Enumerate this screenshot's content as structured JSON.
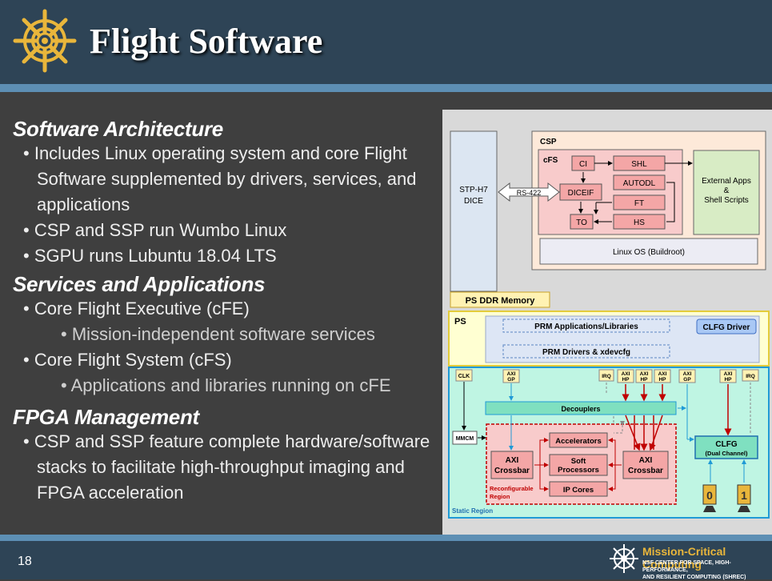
{
  "header": {
    "title": "Flight Software"
  },
  "content": {
    "sections": [
      {
        "heading": "Software Architecture",
        "items": [
          {
            "level": 1,
            "text": "Includes Linux operating system and core Flight Software supplemented by drivers, services, and applications"
          },
          {
            "level": 1,
            "text": "CSP and SSP run Wumbo Linux"
          },
          {
            "level": 1,
            "text": "SGPU runs Lubuntu 18.04 LTS"
          }
        ]
      },
      {
        "heading": "Services and Applications",
        "items": [
          {
            "level": 1,
            "text": "Core Flight Executive (cFE)"
          },
          {
            "level": 2,
            "text": "Mission-independent software services"
          },
          {
            "level": 1,
            "text": "Core Flight System (cFS)"
          },
          {
            "level": 2,
            "text": "Applications and libraries running on cFE"
          }
        ]
      },
      {
        "heading": "FPGA Management",
        "items": [
          {
            "level": 1,
            "text": "CSP and SSP feature complete hardware/software stacks to facilitate high-throughput imaging and FPGA acceleration"
          }
        ]
      }
    ]
  },
  "footer": {
    "page_number": "18",
    "org_name": "Mission-Critical Computing",
    "org_line1": "NSF CENTER FOR SPACE, HIGH-PERFORMANCE,",
    "org_line2": "AND RESILIENT COMPUTING (SHREC)"
  },
  "diagram": {
    "stp_line1": "STP-H7",
    "stp_line2": "DICE",
    "rs422": "RS-422",
    "csp": "CSP",
    "cfs": "cFS",
    "ci": "CI",
    "shl": "SHL",
    "autodl": "AUTODL",
    "diceif": "DICEIF",
    "ft": "FT",
    "to": "TO",
    "hs": "HS",
    "ext_line1": "External Apps",
    "ext_line2": "&",
    "ext_line3": "Shell Scripts",
    "linux_os": "Linux OS (Buildroot)",
    "ps_ddr": "PS DDR Memory",
    "ps": "PS",
    "prm_apps": "PRM Applications/Libraries",
    "clfg_driver": "CLFG Driver",
    "prm_drivers": "PRM Drivers & xdevcfg",
    "clk": "CLK",
    "axi": "AXI",
    "gp": "GP",
    "hp": "HP",
    "irq": "IRQ",
    "decouplers": "Decouplers",
    "mmcm": "MMCM",
    "accelerators": "Accelerators",
    "soft_line1": "Soft",
    "soft_line2": "Processors",
    "ip_cores": "IP Cores",
    "crossbar": "Crossbar",
    "reconf_line1": "Reconfigurable",
    "reconf_line2": "Region",
    "clfg": "CLFG",
    "dual_channel": "(Dual Channel)",
    "static_region": "Static Region",
    "cam0": "0",
    "cam1": "1"
  },
  "colors": {
    "header_bg": "#2e4456",
    "accent_blue": "#5d8fb4",
    "gold": "#e9b63b",
    "static_region": "#bff5e3",
    "reconfigurable": "#f8cbcb",
    "ps_region": "#ffffd2",
    "link_red": "#c00000",
    "link_blue": "#1f9ad6"
  }
}
